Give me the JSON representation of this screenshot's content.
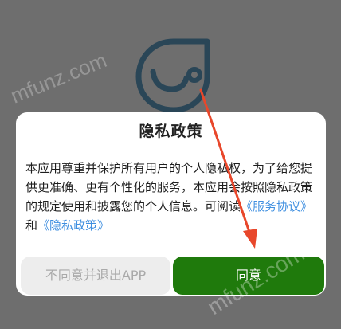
{
  "dialog": {
    "title": "隐私政策",
    "paragraph": "本应用尊重并保护所有用户的个人隐私权，为了给您提供更准确、更有个性化的服务，本应用会按照隐私政策的规定使用和披露您的个人信息。可阅读",
    "link_service": "《服务协议》",
    "and_text": "和",
    "link_privacy": "《隐私政策》",
    "decline_label": "不同意并退出APP",
    "accept_label": "同意"
  },
  "watermark": {
    "text": "mfunz.com"
  },
  "colors": {
    "accent": "#1f7a0c",
    "link": "#3f8fe0",
    "annotation_arrow": "#e8472b",
    "logo": "#2a4657"
  }
}
